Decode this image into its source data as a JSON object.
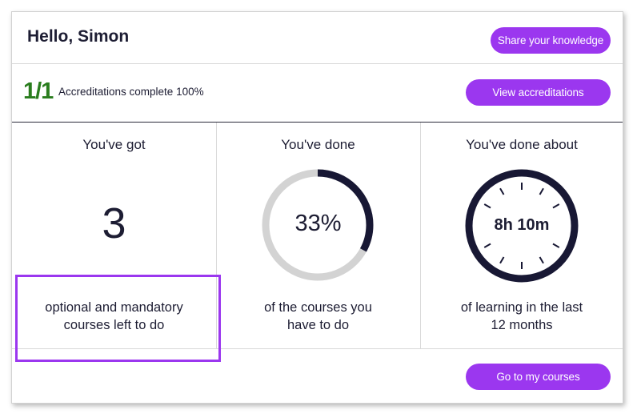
{
  "header": {
    "greeting": "Hello, Simon",
    "share_label": "Share your knowledge"
  },
  "accreditations": {
    "ratio": "1/1",
    "text": "Accreditations complete 100%",
    "button_label": "View accreditations"
  },
  "stats": {
    "courses_left": {
      "title": "You've got",
      "value": "3",
      "caption_line1": "optional and mandatory",
      "caption_line2": "courses left to do"
    },
    "progress": {
      "title": "You've done",
      "percent_label": "33%",
      "fraction": 0.33,
      "caption_line1": "of the courses you",
      "caption_line2": "have to do"
    },
    "learning_time": {
      "title": "You've done about",
      "value": "8h 10m",
      "caption_line1": "of learning in the last",
      "caption_line2": "12 months"
    }
  },
  "footer": {
    "button_label": "Go to my courses"
  },
  "colors": {
    "accent": "#9b37ef",
    "success": "#2a7d1e",
    "ring_fill": "#181834",
    "ring_track": "#d3d3d3"
  }
}
